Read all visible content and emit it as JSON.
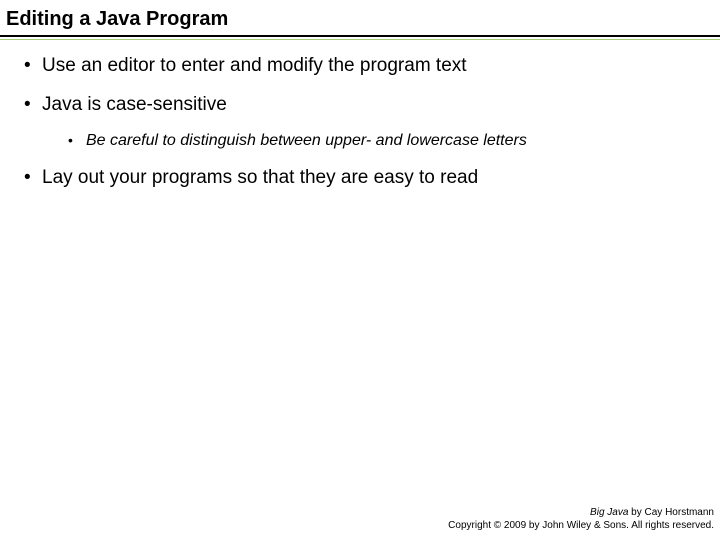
{
  "title": "Editing a Java Program",
  "bullets": [
    {
      "text": "Use an editor to enter and modify the program text",
      "children": []
    },
    {
      "text": "Java is case-sensitive",
      "children": [
        {
          "text": "Be careful to distinguish between upper- and lowercase letters"
        }
      ]
    },
    {
      "text": "Lay out your programs so that they are easy to read",
      "children": []
    }
  ],
  "footer": {
    "book_title": "Big Java",
    "byline_rest": " by Cay Horstmann",
    "copyright": "Copyright © 2009 by John Wiley & Sons.  All rights reserved."
  }
}
